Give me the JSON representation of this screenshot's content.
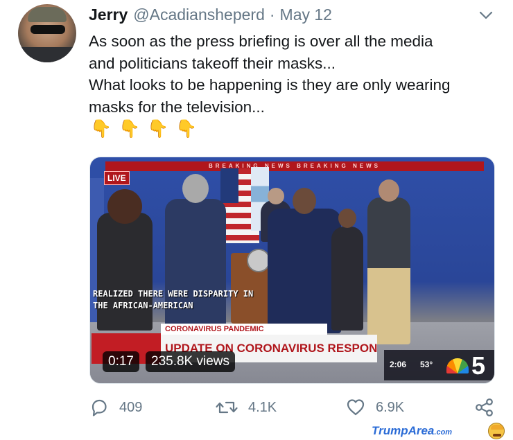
{
  "tweet": {
    "author_name": "Jerry",
    "handle": "@Acadiansheperd",
    "separator": "·",
    "date": "May 12",
    "text_lines": [
      "As soon as the press briefing is over all the media",
      "and politicians takeoff their masks...",
      "What looks to be happening is they are only wearing",
      "masks for the television..."
    ],
    "emojis": [
      "👇",
      "👇",
      "👇",
      "👇"
    ]
  },
  "video": {
    "banner_text": "BREAKING NEWS  BREAKING NEWS",
    "live_label": "LIVE",
    "caption_lines": [
      "REALIZED THERE WERE DISPARITY IN",
      "THE AFRICAN-AMERICAN"
    ],
    "lower_third_label": "CORONAVIRUS PANDEMIC",
    "lower_third_headline": "UPDATE ON CORONAVIRUS RESPONSE IN CHICAGO",
    "clock": "2:06",
    "temperature": "53°",
    "channel": "5",
    "duration": "0:17",
    "views": "235.8K views"
  },
  "actions": {
    "reply_count": "409",
    "retweet_count": "4.1K",
    "like_count": "6.9K"
  },
  "watermark": {
    "site": "TrumpArea",
    "tld": ".com"
  },
  "colors": {
    "text": "#14171a",
    "muted": "#657786",
    "breaking_red": "#b0161c",
    "watermark_blue": "#2a6bd6"
  },
  "icons": [
    "reply-icon",
    "retweet-icon",
    "like-icon",
    "share-icon",
    "chevron-down-icon"
  ]
}
